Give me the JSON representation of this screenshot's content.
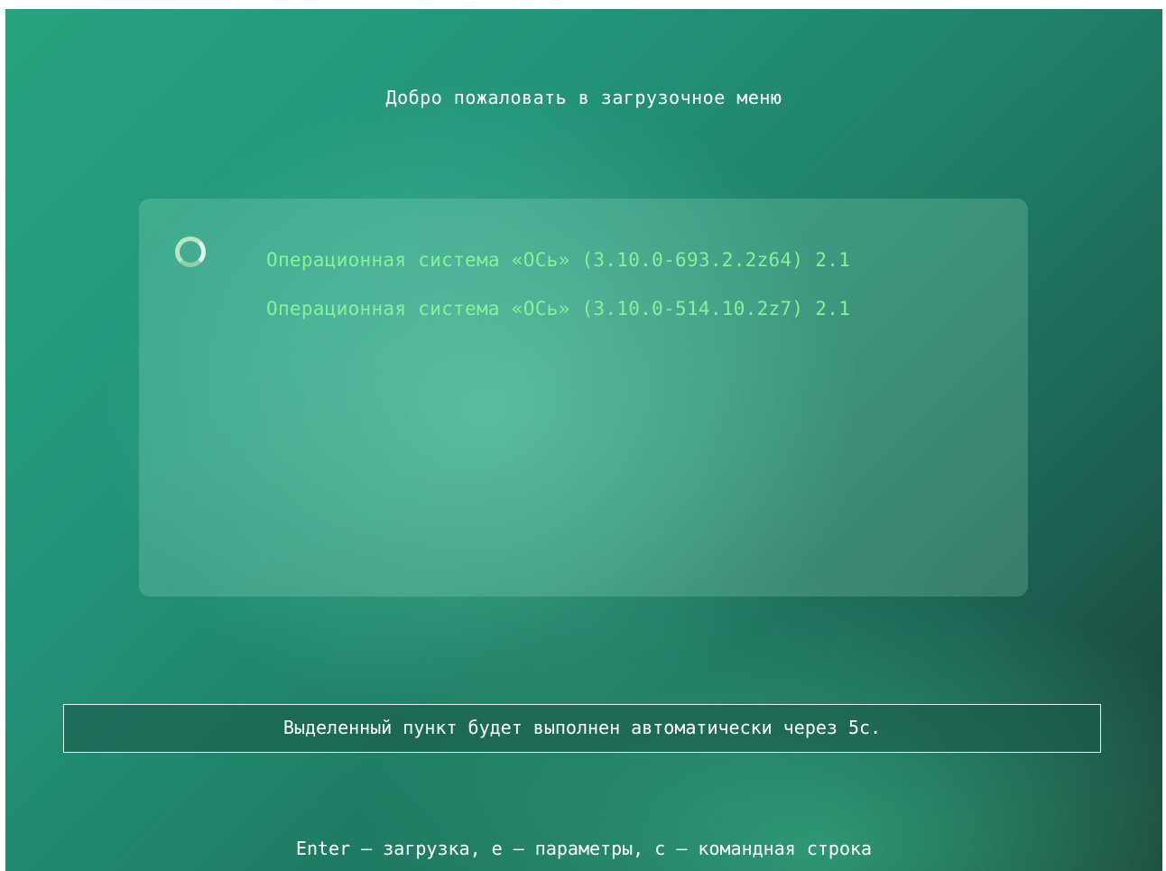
{
  "header": {
    "title": "Добро пожаловать в загрузочное меню"
  },
  "menu": {
    "selected_index": 0,
    "indicator_icon": "spinner-icon",
    "items": [
      {
        "label": "Операционная система «ОСь» (3.10.0-693.2.2z64) 2.1"
      },
      {
        "label": "Операционная система «ОСь» (3.10.0-514.10.2z7) 2.1"
      }
    ]
  },
  "status": {
    "timeout_text": "Выделенный пункт будет выполнен автоматически через 5с."
  },
  "footer": {
    "hint": "Enter – загрузка, e – параметры, c – командная строка"
  },
  "colors": {
    "item_text": "#86f29a",
    "title_text": "#ffffff",
    "background_accent": "#27a37f"
  }
}
